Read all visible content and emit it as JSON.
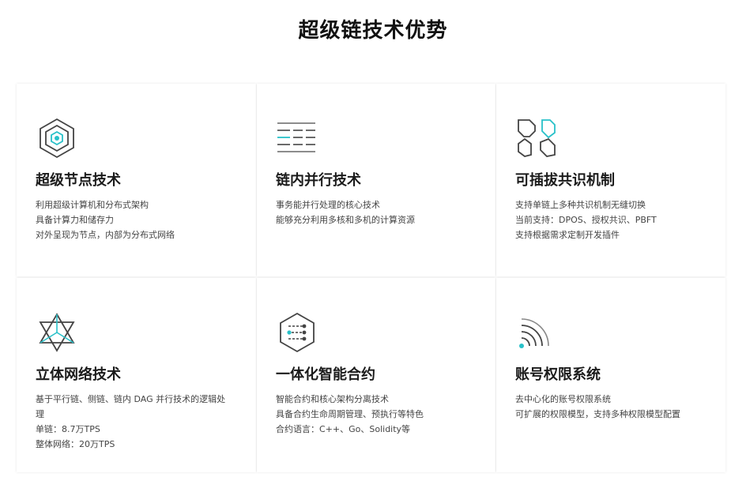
{
  "page": {
    "title": "超级链技术优势"
  },
  "colors": {
    "accent": "#29c1c9",
    "icon": "#444444",
    "text": "#444444"
  },
  "cards": [
    {
      "title": "超级节点技术",
      "icon": "hexagon-node-icon",
      "lines": [
        "利用超级计算机和分布式架构",
        "具备计算力和储存力",
        "对外呈现为节点，内部为分布式网络"
      ]
    },
    {
      "title": "链内并行技术",
      "icon": "parallel-lines-icon",
      "lines": [
        "事务能并行处理的核心技术",
        "能够充分利用多核和多机的计算资源"
      ]
    },
    {
      "title": "可插拔共识机制",
      "icon": "pluggable-puzzle-icon",
      "lines": [
        "支持单链上多种共识机制无缝切换",
        "当前支持：DPOS、授权共识、PBFT",
        "支持根据需求定制开发插件"
      ]
    },
    {
      "title": "立体网络技术",
      "icon": "star-network-icon",
      "lines": [
        "基于平行链、侧链、链内 DAG 并行技术的逻辑处",
        "理",
        "单链：8.7万TPS",
        "整体网络：20万TPS"
      ]
    },
    {
      "title": "一体化智能合约",
      "icon": "smart-contract-icon",
      "lines": [
        "智能合约和核心架构分离技术",
        "具备合约生命周期管理、预执行等特色",
        "合约语言：C++、Go、Solidity等"
      ]
    },
    {
      "title": "账号权限系统",
      "icon": "signal-permission-icon",
      "lines": [
        "去中心化的账号权限系统",
        "可扩展的权限模型，支持多种权限模型配置"
      ]
    }
  ]
}
